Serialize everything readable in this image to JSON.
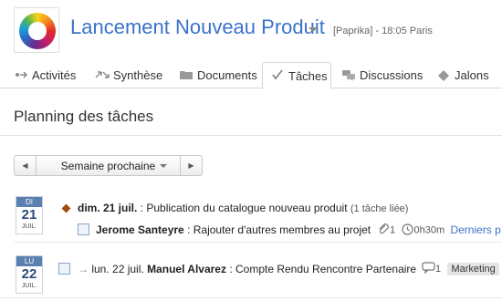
{
  "header": {
    "project_title": "Lancement Nouveau Produit",
    "project_meta": "[Paprika] - 18:05 Paris"
  },
  "tabs": [
    {
      "label": "Activités",
      "icon": "activity-icon"
    },
    {
      "label": "Synthèse",
      "icon": "summary-arrows-icon"
    },
    {
      "label": "Documents",
      "icon": "folder-icon"
    },
    {
      "label": "Tâches",
      "icon": "checkmark-icon",
      "active": true
    },
    {
      "label": "Discussions",
      "icon": "speech-bubbles-icon"
    },
    {
      "label": "Jalons",
      "icon": "diamond-icon"
    }
  ],
  "section_title": "Planning des tâches",
  "week_nav": {
    "selected": "Semaine prochaine"
  },
  "days": [
    {
      "dow": "DI",
      "day": "21",
      "month": "JUIL.",
      "milestone": {
        "date": "dim. 21 juil.",
        "text": " : Publication du catalogue nouveau produit ",
        "link": "(1 tâche liée)"
      },
      "task": {
        "assignee": "Jerome Santeyre",
        "text": " : Rajouter d'autres membres au projet",
        "attachments": "1",
        "duration": "0h30m",
        "link": "Derniers p"
      }
    },
    {
      "dow": "LU",
      "day": "22",
      "month": "JUIL.",
      "task": {
        "arrow": "→",
        "date": "lun. 22 juil.",
        "assignee": "Manuel Alvarez",
        "text": " : Compte Rendu Rencontre Partenaire",
        "comments": "1",
        "tag": "Marketing"
      }
    }
  ],
  "colors": {
    "accent": "#3b73c9",
    "calendar_header": "#5b7fae",
    "milestone": "#a14d14"
  }
}
